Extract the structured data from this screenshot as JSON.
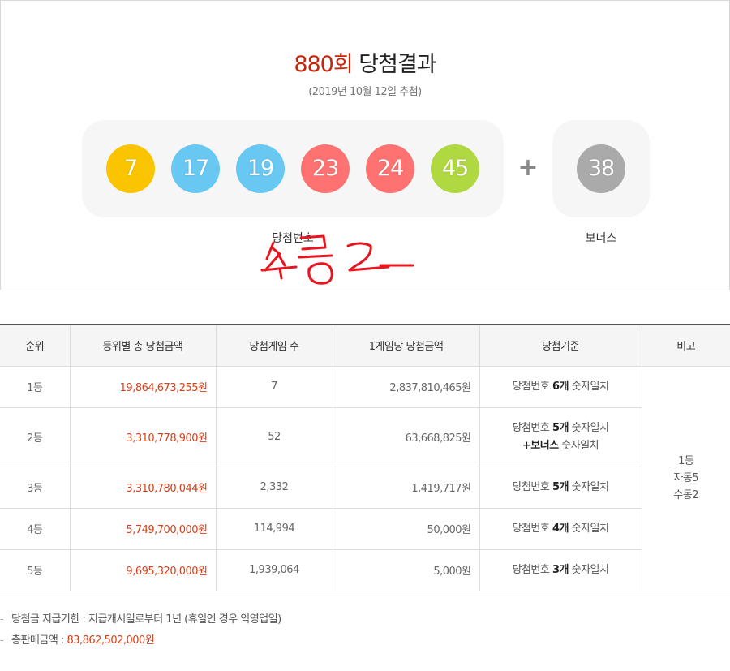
{
  "result": {
    "round": "880회",
    "title_suffix": " 당첨결과",
    "draw_date": "(2019년 10월 12일 추첨)",
    "numbers": [
      {
        "value": "7",
        "color": "#fbc400"
      },
      {
        "value": "17",
        "color": "#69c8f2"
      },
      {
        "value": "19",
        "color": "#69c8f2"
      },
      {
        "value": "23",
        "color": "#ff7272"
      },
      {
        "value": "24",
        "color": "#ff7272"
      },
      {
        "value": "45",
        "color": "#b0d840"
      }
    ],
    "plus_sign": "+",
    "bonus": {
      "value": "38",
      "color": "#aaaaaa"
    },
    "win_label": "당첨번호",
    "bonus_label": "보너스",
    "handwritten_note": "수동 2"
  },
  "table": {
    "headers": [
      "순위",
      "등위별 총 당첨금액",
      "당첨게임 수",
      "1게임당 당첨금액",
      "당첨기준",
      "비고"
    ],
    "rows": [
      {
        "rank": "1등",
        "total": "19,864,673,255원",
        "winners": "7",
        "per_game": "2,837,810,465원",
        "crit_pre": "당첨번호 ",
        "crit_bold": "6개",
        "crit_post": " 숫자일치",
        "crit_line2_bold": "",
        "crit_line2_post": ""
      },
      {
        "rank": "2등",
        "total": "3,310,778,900원",
        "winners": "52",
        "per_game": "63,668,825원",
        "crit_pre": "당첨번호 ",
        "crit_bold": "5개",
        "crit_post": " 숫자일치",
        "crit_line2_bold": "+보너스",
        "crit_line2_post": " 숫자일치"
      },
      {
        "rank": "3등",
        "total": "3,310,780,044원",
        "winners": "2,332",
        "per_game": "1,419,717원",
        "crit_pre": "당첨번호 ",
        "crit_bold": "5개",
        "crit_post": " 숫자일치",
        "crit_line2_bold": "",
        "crit_line2_post": ""
      },
      {
        "rank": "4등",
        "total": "5,749,700,000원",
        "winners": "114,994",
        "per_game": "50,000원",
        "crit_pre": "당첨번호 ",
        "crit_bold": "4개",
        "crit_post": " 숫자일치",
        "crit_line2_bold": "",
        "crit_line2_post": ""
      },
      {
        "rank": "5등",
        "total": "9,695,320,000원",
        "winners": "1,939,064",
        "per_game": "5,000원",
        "crit_pre": "당첨번호 ",
        "crit_bold": "3개",
        "crit_post": " 숫자일치",
        "crit_line2_bold": "",
        "crit_line2_post": ""
      }
    ],
    "note_lines": [
      "1등",
      "자동5",
      "수동2"
    ]
  },
  "footnotes": {
    "deadline": "당첨금 지급기한 : 지급개시일로부터 1년 (휴일인 경우 익영업일)",
    "sales_label": "총판매금액 : ",
    "sales_value": "83,862,502,000원",
    "dash": "-"
  },
  "colors": {
    "accent_red": "#c8260c",
    "amount_red": "#d5411a",
    "marker_red": "#e8141e"
  }
}
